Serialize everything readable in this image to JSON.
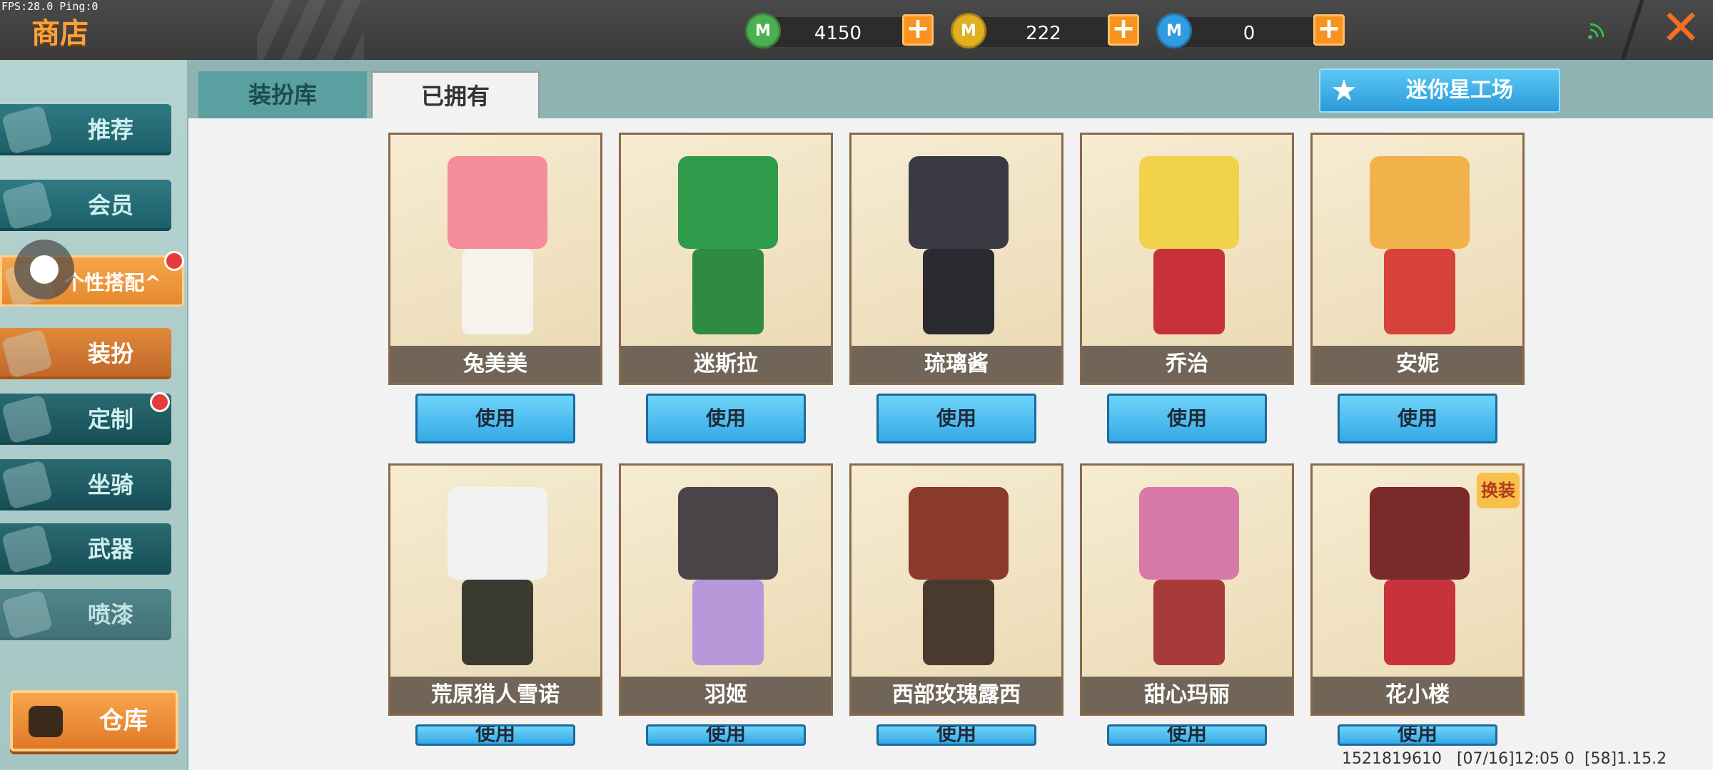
{
  "status": {
    "fps_text": "FPS:28.0  Ping:0"
  },
  "header": {
    "title": "商店",
    "currencies": [
      {
        "icon": "green-gem-icon",
        "coin_letter": "M",
        "amount": "4150",
        "color": "#4caf50"
      },
      {
        "icon": "gold-coin-icon",
        "coin_letter": "M",
        "amount": "222",
        "color": "#e0b020"
      },
      {
        "icon": "blue-coin-icon",
        "coin_letter": "M",
        "amount": "0",
        "color": "#2f9be0"
      }
    ],
    "plus_label": "+",
    "close_label": "✕"
  },
  "sidebar": {
    "items": [
      {
        "label": "推荐",
        "icon": "thumbs-up-icon"
      },
      {
        "label": "会员",
        "icon": "vip-icon"
      },
      {
        "label": "个性搭配",
        "icon": "trophy-icon",
        "suffix": "^"
      },
      {
        "label": "装扮",
        "icon": "shirt-icon"
      },
      {
        "label": "定制",
        "icon": "brush-icon"
      },
      {
        "label": "坐骑",
        "icon": "mount-icon"
      },
      {
        "label": "武器",
        "icon": "gun-icon"
      },
      {
        "label": "喷漆",
        "icon": "spray-icon"
      }
    ],
    "warehouse_label": "仓库"
  },
  "tabs": {
    "library": "装扮库",
    "owned": "已拥有"
  },
  "workshop_label": "迷你星工场",
  "use_label": "使用",
  "cards": [
    {
      "name": "兔美美",
      "head": "#f48c9a",
      "body": "#f7f2ec"
    },
    {
      "name": "迷斯拉",
      "head": "#2f9a4a",
      "body": "#2f8a42"
    },
    {
      "name": "琉璃酱",
      "head": "#3a3a44",
      "body": "#2a2a30"
    },
    {
      "name": "乔治",
      "head": "#f2d24a",
      "body": "#c8313a"
    },
    {
      "name": "安妮",
      "head": "#f2b24a",
      "body": "#d6423a"
    },
    {
      "name": "荒原猎人雪诺",
      "head": "#f2f2f2",
      "body": "#3a3a30"
    },
    {
      "name": "羽姬",
      "head": "#4a4448",
      "body": "#b898d8"
    },
    {
      "name": "西部玫瑰露西",
      "head": "#8a3a2a",
      "body": "#4a3a2e"
    },
    {
      "name": "甜心玛丽",
      "head": "#d87aa8",
      "body": "#a83a3a"
    },
    {
      "name": "花小楼",
      "head": "#7a2a2a",
      "body": "#c8323a",
      "badge": "换装"
    }
  ],
  "footer": {
    "uid": "1521819610",
    "time": "[07/16]12:05 0",
    "version": "[58]1.15.2"
  }
}
